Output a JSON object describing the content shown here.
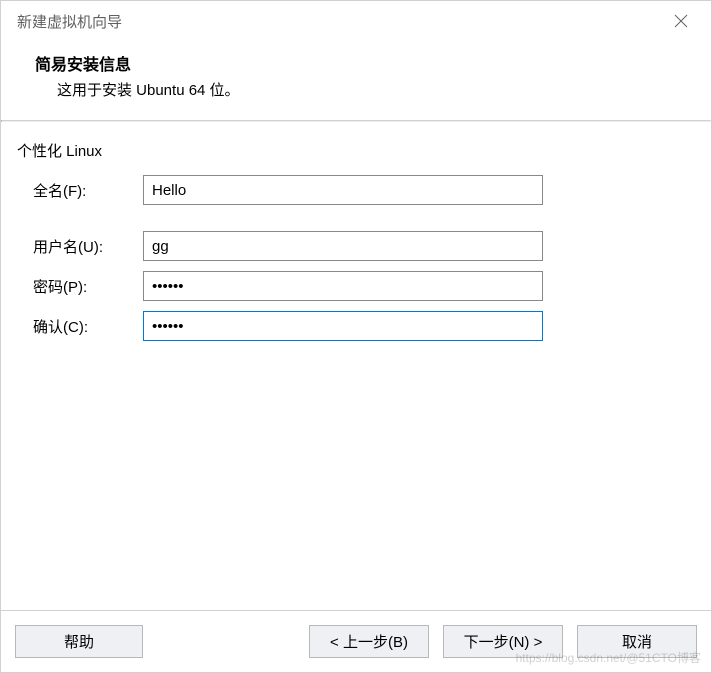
{
  "titlebar": {
    "title": "新建虚拟机向导"
  },
  "header": {
    "heading": "简易安装信息",
    "subheading": "这用于安装 Ubuntu 64 位。"
  },
  "form": {
    "section_title": "个性化 Linux",
    "full_name": {
      "label": "全名(F):",
      "value": "Hello"
    },
    "user_name": {
      "label": "用户名(U):",
      "value": "gg"
    },
    "password": {
      "label": "密码(P):",
      "value": "••••••"
    },
    "confirm": {
      "label": "确认(C):",
      "value": "••••••"
    }
  },
  "buttons": {
    "help": "帮助",
    "back": "< 上一步(B)",
    "next": "下一步(N) >",
    "cancel": "取消"
  },
  "watermark": "https://blog.csdn.net/@51CTO博客"
}
